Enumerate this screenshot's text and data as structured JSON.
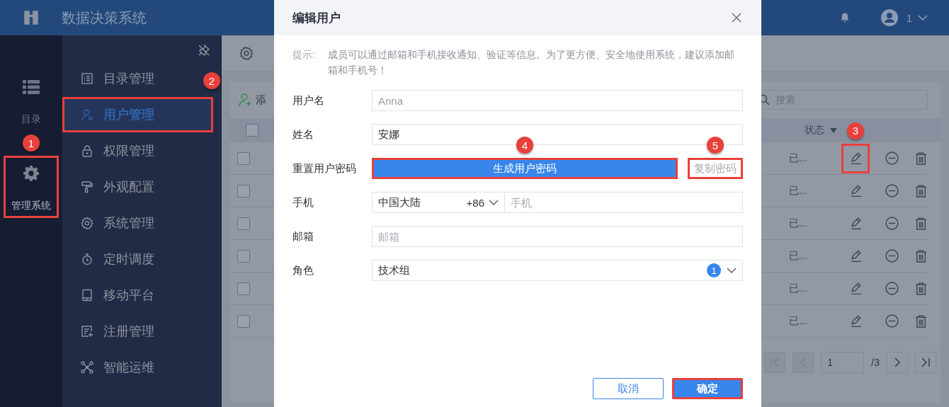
{
  "app": {
    "title": "数据决策系统",
    "user": "1"
  },
  "rail": [
    {
      "kind": "catalog",
      "label": "目录",
      "selected": false,
      "highlighted": false
    },
    {
      "kind": "admin",
      "label": "管理系统",
      "selected": true,
      "highlighted": true,
      "callout": "1"
    }
  ],
  "menu": [
    {
      "kind": "catalog",
      "label": "目录管理",
      "selected": false,
      "highlighted": false
    },
    {
      "kind": "user",
      "label": "用户管理",
      "selected": true,
      "highlighted": true,
      "callout": "2"
    },
    {
      "kind": "lock",
      "label": "权限管理",
      "selected": false,
      "highlighted": false
    },
    {
      "kind": "brush",
      "label": "外观配置",
      "selected": false,
      "highlighted": false
    },
    {
      "kind": "gear",
      "label": "系统管理",
      "selected": false,
      "highlighted": false
    },
    {
      "kind": "timer",
      "label": "定时调度",
      "selected": false,
      "highlighted": false
    },
    {
      "kind": "tablet",
      "label": "移动平台",
      "selected": false,
      "highlighted": false
    },
    {
      "kind": "register",
      "label": "注册管理",
      "selected": false,
      "highlighted": false
    },
    {
      "kind": "network",
      "label": "智能运维",
      "selected": false,
      "highlighted": false
    }
  ],
  "toolbar": {
    "add": "添",
    "search_placeholder": "搜索"
  },
  "table": {
    "status_header": "状态",
    "all_checked": false,
    "rows": [
      {
        "status": "已...",
        "checked": false,
        "edit_highlighted": true,
        "edit_callout": "3"
      },
      {
        "status": "已...",
        "checked": false,
        "edit_highlighted": false
      },
      {
        "status": "已...",
        "checked": false,
        "edit_highlighted": false
      },
      {
        "status": "已...",
        "checked": false,
        "edit_highlighted": false
      },
      {
        "status": "已...",
        "checked": false,
        "edit_highlighted": false
      },
      {
        "status": "已...",
        "checked": false,
        "edit_highlighted": false
      }
    ]
  },
  "pagination": {
    "page": "1",
    "total": "/3"
  },
  "dialog": {
    "title": "编辑用户",
    "hint_label": "提示:",
    "hint": "成员可以通过邮箱和手机接收通知、验证等信息。为了更方便、安全地使用系统，建议添加邮箱和手机号！",
    "fields": [
      {
        "kind": "text",
        "label": "用户名",
        "value": "Anna",
        "disabled": true
      },
      {
        "kind": "text",
        "label": "姓名",
        "value": "安娜",
        "disabled": false
      },
      {
        "kind": "password",
        "label": "重置用户密码",
        "button": "生成用户密码",
        "button_highlighted": true,
        "button_callout": "4",
        "copy": "复制密码",
        "copy_disabled": true,
        "copy_highlighted": true,
        "copy_callout": "5"
      },
      {
        "kind": "phone",
        "label": "手机",
        "region": "中国大陆",
        "code": "+86",
        "placeholder": "手机"
      },
      {
        "kind": "text",
        "label": "邮箱",
        "placeholder": "邮箱"
      },
      {
        "kind": "select",
        "label": "角色",
        "value": "技术组",
        "count": "1"
      }
    ],
    "buttons": [
      {
        "kind": "cancel",
        "label": "取消",
        "highlighted": false
      },
      {
        "kind": "ok",
        "label": "确定",
        "highlighted": true
      }
    ]
  }
}
